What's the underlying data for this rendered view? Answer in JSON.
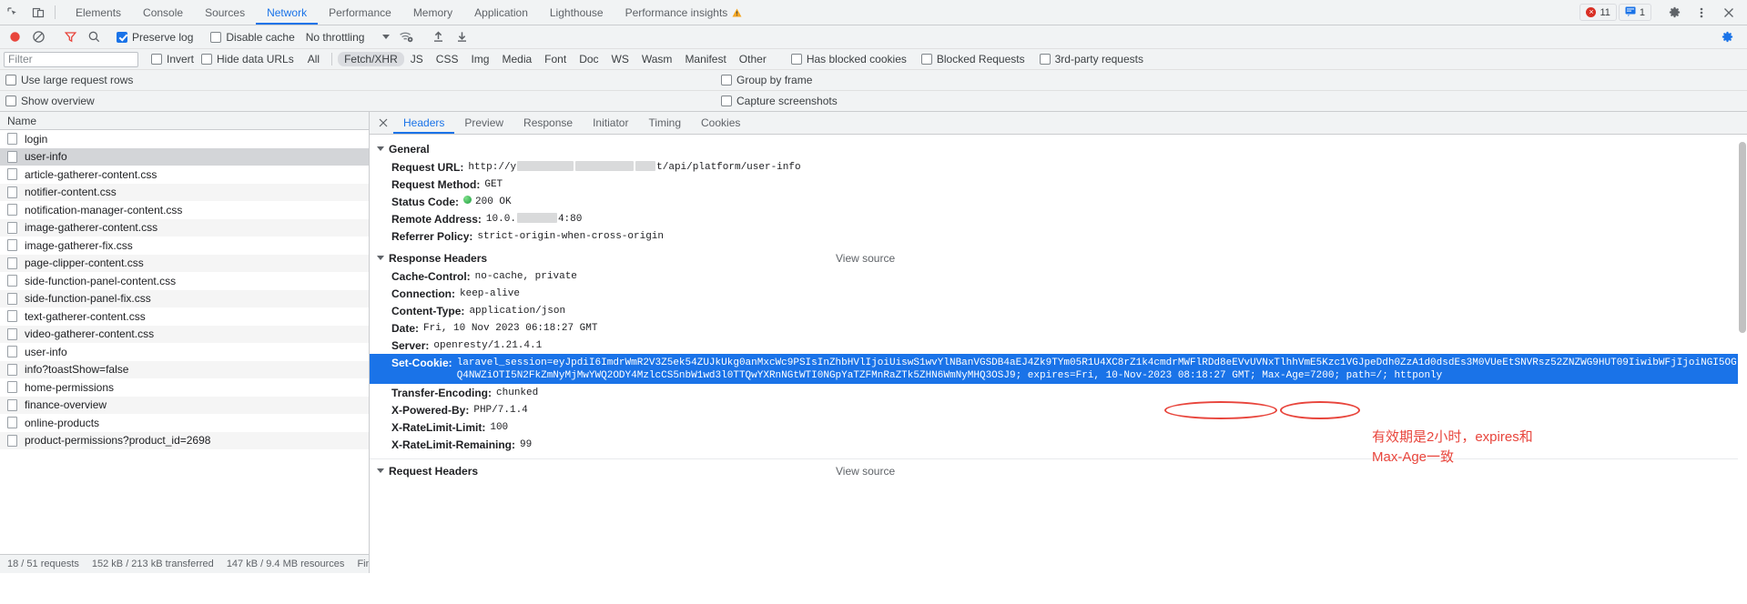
{
  "devtools": {
    "icons": {
      "inspect": "inspect-element-icon",
      "device": "device-toolbar-icon"
    },
    "tabs": [
      {
        "label": "Elements",
        "selected": false
      },
      {
        "label": "Console",
        "selected": false
      },
      {
        "label": "Sources",
        "selected": false
      },
      {
        "label": "Network",
        "selected": true
      },
      {
        "label": "Performance",
        "selected": false
      },
      {
        "label": "Memory",
        "selected": false
      },
      {
        "label": "Application",
        "selected": false
      },
      {
        "label": "Lighthouse",
        "selected": false
      },
      {
        "label": "Performance insights",
        "selected": false,
        "warning": true
      }
    ],
    "error_count": "11",
    "message_count": "1",
    "settings_icon": "gear-icon",
    "more_icon": "kebab-menu-icon",
    "close_icon": "close-icon"
  },
  "network_toolbar": {
    "record_icon": "record-stop-icon",
    "clear_icon": "clear-network-log-icon",
    "filter_icon": "filter-funnel-icon",
    "search_icon": "search-icon",
    "preserve_log": {
      "label": "Preserve log",
      "checked": true
    },
    "disable_cache": {
      "label": "Disable cache",
      "checked": false
    },
    "throttling": "No throttling",
    "wifi_icon": "network-conditions-icon",
    "import_icon": "import-har-icon",
    "export_icon": "export-har-icon",
    "settings_icon": "network-settings-gear-icon"
  },
  "filter_row": {
    "placeholder": "Filter",
    "value": "",
    "invert": {
      "label": "Invert",
      "checked": false
    },
    "hide_data_urls": {
      "label": "Hide data URLs",
      "checked": false
    },
    "types": [
      {
        "label": "All",
        "active": false
      },
      {
        "label": "Fetch/XHR",
        "active": true
      },
      {
        "label": "JS",
        "active": false
      },
      {
        "label": "CSS",
        "active": false
      },
      {
        "label": "Img",
        "active": false
      },
      {
        "label": "Media",
        "active": false
      },
      {
        "label": "Font",
        "active": false
      },
      {
        "label": "Doc",
        "active": false
      },
      {
        "label": "WS",
        "active": false
      },
      {
        "label": "Wasm",
        "active": false
      },
      {
        "label": "Manifest",
        "active": false
      },
      {
        "label": "Other",
        "active": false
      }
    ],
    "has_blocked_cookies": {
      "label": "Has blocked cookies",
      "checked": false
    },
    "blocked_requests": {
      "label": "Blocked Requests",
      "checked": false
    },
    "third_party": {
      "label": "3rd-party requests",
      "checked": false
    }
  },
  "options": {
    "large_rows": {
      "label": "Use large request rows",
      "checked": false
    },
    "group_by_frame": {
      "label": "Group by frame",
      "checked": false
    },
    "show_overview": {
      "label": "Show overview",
      "checked": false
    },
    "capture_screenshots": {
      "label": "Capture screenshots",
      "checked": false
    }
  },
  "request_list": {
    "column_header": "Name",
    "rows": [
      {
        "name": "login",
        "selected": false
      },
      {
        "name": "user-info",
        "selected": true
      },
      {
        "name": "article-gatherer-content.css",
        "selected": false
      },
      {
        "name": "notifier-content.css",
        "selected": false
      },
      {
        "name": "notification-manager-content.css",
        "selected": false
      },
      {
        "name": "image-gatherer-content.css",
        "selected": false
      },
      {
        "name": "image-gatherer-fix.css",
        "selected": false
      },
      {
        "name": "page-clipper-content.css",
        "selected": false
      },
      {
        "name": "side-function-panel-content.css",
        "selected": false
      },
      {
        "name": "side-function-panel-fix.css",
        "selected": false
      },
      {
        "name": "text-gatherer-content.css",
        "selected": false
      },
      {
        "name": "video-gatherer-content.css",
        "selected": false
      },
      {
        "name": "user-info",
        "selected": false
      },
      {
        "name": "info?toastShow=false",
        "selected": false
      },
      {
        "name": "home-permissions",
        "selected": false
      },
      {
        "name": "finance-overview",
        "selected": false
      },
      {
        "name": "online-products",
        "selected": false
      },
      {
        "name": "product-permissions?product_id=2698",
        "selected": false
      }
    ],
    "status_bar": [
      "18 / 51 requests",
      "152 kB / 213 kB transferred",
      "147 kB / 9.4 MB resources",
      "Fin"
    ]
  },
  "detail": {
    "close_label": "✕",
    "tabs": [
      {
        "label": "Headers",
        "selected": true
      },
      {
        "label": "Preview",
        "selected": false
      },
      {
        "label": "Response",
        "selected": false
      },
      {
        "label": "Initiator",
        "selected": false
      },
      {
        "label": "Timing",
        "selected": false
      },
      {
        "label": "Cookies",
        "selected": false
      }
    ],
    "general": {
      "title": "General",
      "request_url_label": "Request URL:",
      "request_url_prefix": "http://y",
      "request_url_suffix": "t/api/platform/user-info",
      "request_method_label": "Request Method:",
      "request_method": "GET",
      "status_code_label": "Status Code:",
      "status_code": "200 OK",
      "remote_address_label": "Remote Address:",
      "remote_address_prefix": "10.0.",
      "remote_address_suffix": "4:80",
      "referrer_policy_label": "Referrer Policy:",
      "referrer_policy": "strict-origin-when-cross-origin"
    },
    "response_headers": {
      "title": "Response Headers",
      "view_source": "View source",
      "items": [
        {
          "name": "Cache-Control:",
          "value": "no-cache, private"
        },
        {
          "name": "Connection:",
          "value": "keep-alive"
        },
        {
          "name": "Content-Type:",
          "value": "application/json"
        },
        {
          "name": "Date:",
          "value": "Fri, 10 Nov 2023 06:18:27 GMT"
        },
        {
          "name": "Server:",
          "value": "openresty/1.21.4.1"
        },
        {
          "name": "Transfer-Encoding:",
          "value": "chunked"
        },
        {
          "name": "X-Powered-By:",
          "value": "PHP/7.1.4"
        },
        {
          "name": "X-RateLimit-Limit:",
          "value": "100"
        },
        {
          "name": "X-RateLimit-Remaining:",
          "value": "99"
        }
      ],
      "set_cookie": {
        "name": "Set-Cookie:",
        "value": "laravel_session=eyJpdiI6ImdrWmR2V3Z5ek54ZUJkUkg0anMxcWc9PSIsInZhbHVlIjoiUiswS1wvYlNBanVGSDB4aEJ4Zk9TYm05R1U4XC8rZ1k4cmdrMWFlRDd8eEVvUVNxTlhhVmE5Kzc1VGJpeDdh0ZzA1d0dsdEs3M0VUeEtSNVRsz52ZNZWG9HUT09IiwibWFjIjoiNGI5OGQ4NWZiOTI5N2FkZmNyMjMwYWQ2ODY4MzlcCS5nbW1wd3l0TTQwYXRnNGtWTI0NGpYaTZFMnRaZTk5ZHN6WmNyMHQ3OSJ9; expires=Fri, 10-Nov-2023 08:18:27 GMT; Max-Age=7200; path=/; httponly"
      }
    },
    "request_headers": {
      "title": "Request Headers",
      "view_source": "View source"
    },
    "annotation": "有效期是2小时，expires和\nMax-Age一致"
  }
}
